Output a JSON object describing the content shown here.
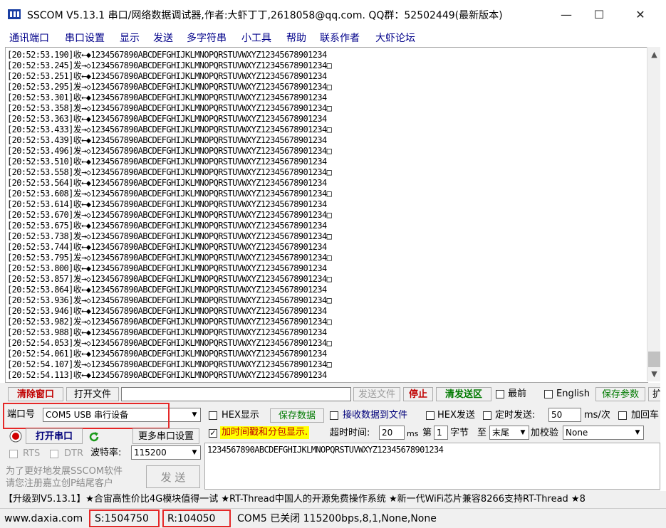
{
  "window": {
    "title": "SSCOM V5.13.1 串口/网络数据调试器,作者:大虾丁丁,2618058@qq.com. QQ群：52502449(最新版本)",
    "minimize": "—",
    "maximize": "☐",
    "close": "✕"
  },
  "menu": [
    "通讯端口",
    "串口设置",
    "显示",
    "发送",
    "多字符串",
    "小工具",
    "帮助",
    "联系作者",
    "大虾论坛"
  ],
  "log": [
    "[20:52:53.190]收←◆1234567890ABCDEFGHIJKLMNOPQRSTUVWXYZ12345678901234",
    "[20:52:53.245]发→◇1234567890ABCDEFGHIJKLMNOPQRSTUVWXYZ12345678901234□",
    "[20:52:53.251]收←◆1234567890ABCDEFGHIJKLMNOPQRSTUVWXYZ12345678901234",
    "[20:52:53.295]发→◇1234567890ABCDEFGHIJKLMNOPQRSTUVWXYZ12345678901234□",
    "[20:52:53.301]收←◆1234567890ABCDEFGHIJKLMNOPQRSTUVWXYZ12345678901234",
    "[20:52:53.358]发→◇1234567890ABCDEFGHIJKLMNOPQRSTUVWXYZ12345678901234□",
    "[20:52:53.363]收←◆1234567890ABCDEFGHIJKLMNOPQRSTUVWXYZ12345678901234",
    "[20:52:53.433]发→◇1234567890ABCDEFGHIJKLMNOPQRSTUVWXYZ12345678901234□",
    "[20:52:53.439]收←◆1234567890ABCDEFGHIJKLMNOPQRSTUVWXYZ12345678901234",
    "[20:52:53.496]发→◇1234567890ABCDEFGHIJKLMNOPQRSTUVWXYZ12345678901234□",
    "[20:52:53.510]收←◆1234567890ABCDEFGHIJKLMNOPQRSTUVWXYZ12345678901234",
    "[20:52:53.558]发→◇1234567890ABCDEFGHIJKLMNOPQRSTUVWXYZ12345678901234□",
    "[20:52:53.564]收←◆1234567890ABCDEFGHIJKLMNOPQRSTUVWXYZ12345678901234",
    "[20:52:53.608]发→◇1234567890ABCDEFGHIJKLMNOPQRSTUVWXYZ12345678901234□",
    "[20:52:53.614]收←◆1234567890ABCDEFGHIJKLMNOPQRSTUVWXYZ12345678901234",
    "[20:52:53.670]发→◇1234567890ABCDEFGHIJKLMNOPQRSTUVWXYZ12345678901234□",
    "[20:52:53.675]收←◆1234567890ABCDEFGHIJKLMNOPQRSTUVWXYZ12345678901234",
    "[20:52:53.738]发→◇1234567890ABCDEFGHIJKLMNOPQRSTUVWXYZ12345678901234□",
    "[20:52:53.744]收←◆1234567890ABCDEFGHIJKLMNOPQRSTUVWXYZ12345678901234",
    "[20:52:53.795]发→◇1234567890ABCDEFGHIJKLMNOPQRSTUVWXYZ12345678901234□",
    "[20:52:53.800]收←◆1234567890ABCDEFGHIJKLMNOPQRSTUVWXYZ12345678901234",
    "[20:52:53.857]发→◇1234567890ABCDEFGHIJKLMNOPQRSTUVWXYZ12345678901234□",
    "[20:52:53.864]收←◆1234567890ABCDEFGHIJKLMNOPQRSTUVWXYZ12345678901234",
    "[20:52:53.936]发→◇1234567890ABCDEFGHIJKLMNOPQRSTUVWXYZ12345678901234□",
    "[20:52:53.946]收←◆1234567890ABCDEFGHIJKLMNOPQRSTUVWXYZ12345678901234",
    "[20:52:53.982]发→◇1234567890ABCDEFGHIJKLMNOPQRSTUVWXYZ12345678901234□",
    "[20:52:53.988]收←◆1234567890ABCDEFGHIJKLMNOPQRSTUVWXYZ12345678901234",
    "[20:52:54.053]发→◇1234567890ABCDEFGHIJKLMNOPQRSTUVWXYZ12345678901234□",
    "[20:52:54.061]收←◆1234567890ABCDEFGHIJKLMNOPQRSTUVWXYZ12345678901234",
    "[20:52:54.107]发→◇1234567890ABCDEFGHIJKLMNOPQRSTUVWXYZ12345678901234□",
    "[20:52:54.113]收←◆1234567890ABCDEFGHIJKLMNOPQRSTUVWXYZ12345678901234"
  ],
  "toolbar1": {
    "clear_window": "清除窗口",
    "open_file": "打开文件",
    "file_path": "",
    "send_file": "发送文件",
    "stop": "停止",
    "clear_send": "清发送区",
    "topmost": "最前",
    "english": "English",
    "save_params": "保存参数",
    "expand": "扩"
  },
  "port": {
    "label": "端口号",
    "value": "COM5 USB 串行设备",
    "open_button": "打开串口",
    "more_settings": "更多串口设置",
    "rts": "RTS",
    "dtr": "DTR",
    "baud_label": "波特率:",
    "baud_value": "115200"
  },
  "options": {
    "hex_display": "HEX显示",
    "save_data": "保存数据",
    "recv_to_file": "接收数据到文件",
    "hex_send": "HEX发送",
    "timed_send": "定时发送:",
    "interval": "50",
    "interval_unit": "ms/次",
    "add_newline": "加回车",
    "timestamp": "加时间戳和分包显示.",
    "timeout_label": "超时时间:",
    "timeout_value": "20",
    "timeout_unit": "ms",
    "byte_prefix": "第",
    "byte_value": "1",
    "byte_unit": "字节",
    "to": "至",
    "end_value": "末尾",
    "checksum_label": "加校验",
    "checksum_value": "None"
  },
  "promo": {
    "line1": "为了更好地发展SSCOM软件",
    "line2": "请您注册嘉立创P结尾客户"
  },
  "send_button": "发 送",
  "send_text": "1234567890ABCDEFGHIJKLMNOPQRSTUVWXYZ12345678901234",
  "ticker": "【升级到V5.13.1】★合宙高性价比4G模块值得一试 ★RT-Thread中国人的开源免费操作系统 ★新一代WiFi芯片兼容8266支持RT-Thread ★8",
  "status": {
    "site": "www.daxia.com",
    "sent": "S:1504750",
    "received": "R:104050",
    "port_state": "COM5 已关闭  115200bps,8,1,None,None"
  },
  "colors": {
    "highlight_box": "#e52828",
    "menu_text": "#00008a",
    "stop_text": "#c00000",
    "green_text": "#007a00",
    "timestamp_bg": "#ffff00"
  }
}
